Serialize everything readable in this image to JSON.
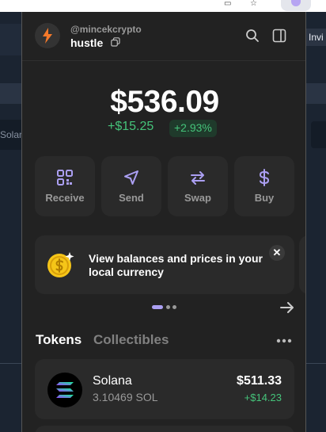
{
  "background": {
    "left_tab_text": "Solan",
    "right_button_text": "Invi"
  },
  "header": {
    "username": "@mincekcrypto",
    "account_name": "hustle"
  },
  "balance": {
    "total": "$536.09",
    "change_usd": "+$15.25",
    "change_pct": "+2.93%"
  },
  "actions": [
    {
      "label": "Receive",
      "icon": "qr-code-icon"
    },
    {
      "label": "Send",
      "icon": "send-icon"
    },
    {
      "label": "Swap",
      "icon": "swap-icon"
    },
    {
      "label": "Buy",
      "icon": "dollar-icon"
    }
  ],
  "banner": {
    "text": "View balances and prices in your local currency",
    "close": "✕"
  },
  "tabs": {
    "tokens": "Tokens",
    "collectibles": "Collectibles"
  },
  "tokens": [
    {
      "name": "Solana",
      "amount": "3.10469 SOL",
      "value": "$511.33",
      "change": "+$14.23"
    }
  ],
  "colors": {
    "accent": "#ab9ff2",
    "positive": "#45c37a",
    "panel": "#222222",
    "card": "#2a2a2a"
  }
}
